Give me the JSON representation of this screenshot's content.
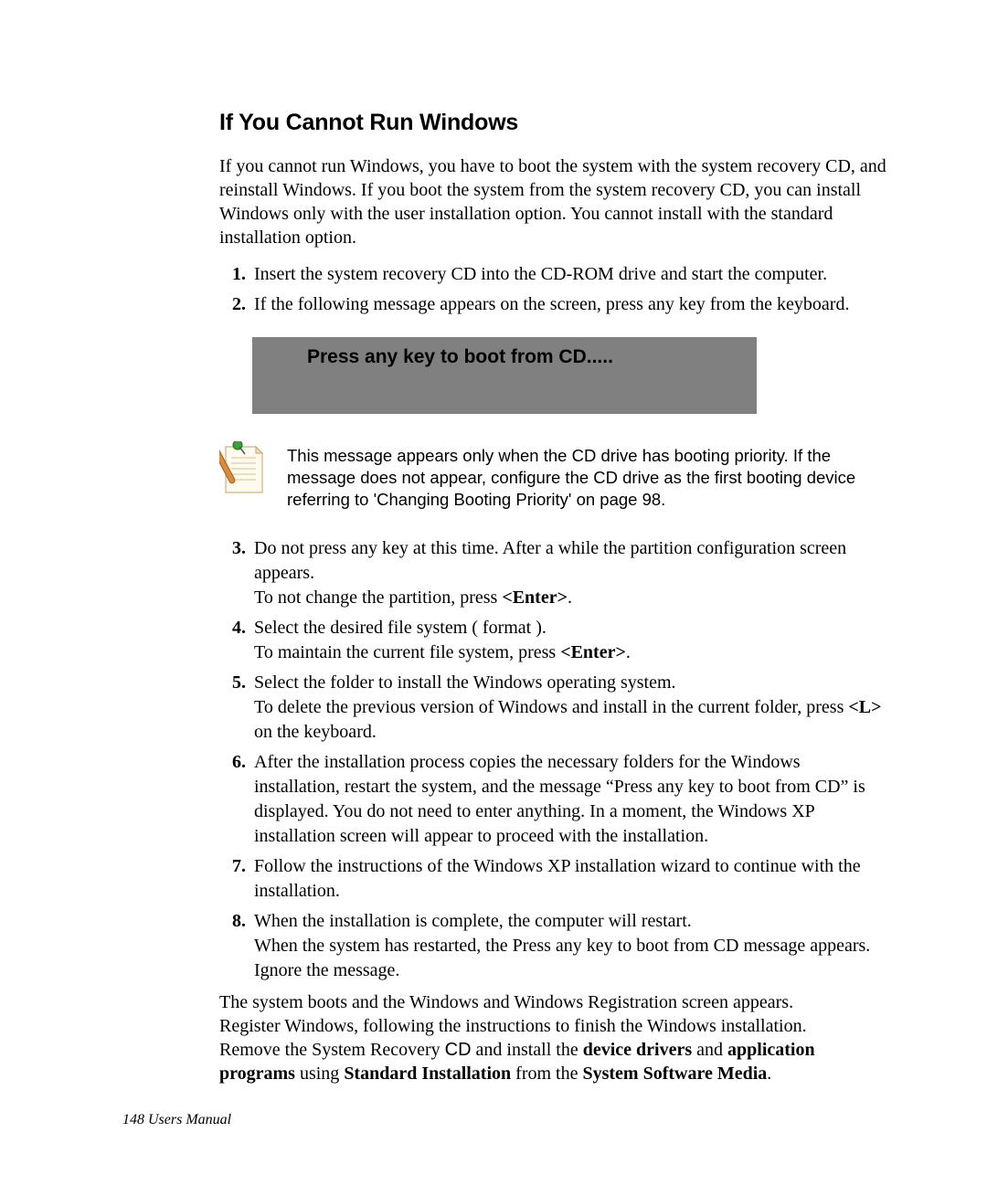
{
  "section": {
    "title": "If You Cannot Run Windows",
    "intro": "If you cannot run Windows, you have to boot the system with the system recovery CD, and reinstall Windows. If you boot the system from the system recovery CD, you can install Windows only with the user installation option. You cannot install with the standard installation option."
  },
  "steps": {
    "s1": "Insert the system recovery CD into the CD-ROM drive and start the computer.",
    "s2": "If the following message appears on the screen, press any key from the keyboard.",
    "s3a": " Do not press any key at this time. After a while the partition configuration screen appears.",
    "s3b_pre": "To not change the partition, press ",
    "s3_enter": "<Enter>",
    "s3b_post": ".",
    "s4a": "Select the desired file system ( format ).",
    "s4b_pre": "To maintain the current file system, press ",
    "s4b_post": ".",
    "s5a": "Select the folder to install the Windows operating system.",
    "s5b_pre": "To delete the previous version of Windows and install in the current folder, press ",
    "s5_L": "<L>",
    "s5b_post": " on the keyboard.",
    "s6": "After the installation process copies the necessary folders for the Windows installation, restart the system, and the message “Press any key to boot from CD” is displayed. You do not need to enter anything. In a moment, the Windows XP installation screen will appear to proceed with the installation.",
    "s7": "Follow the instructions of the Windows XP installation wizard to continue with the installation.",
    "s8a": "When the installation is complete, the computer will restart.",
    "s8b": "When the system has restarted, the Press any key to boot from CD message appears. Ignore the message."
  },
  "bootbox": {
    "text": "Press any key to  boot from CD....."
  },
  "note": {
    "text": "This message appears only when the CD drive has booting priority. If the message does not appear, configure the CD drive as the first booting device referring to 'Changing Booting Priority' on page 98."
  },
  "closing": {
    "line1": "The system boots and the Windows and Windows Registration screen appears.",
    "line2": "Register Windows, following the instructions to finish the Windows installation.",
    "line3_pre": "Remove the System Recovery ",
    "line3_cd": "CD",
    "line3_mid1": " and install the ",
    "b_device": "device drivers",
    "line3_and": " and ",
    "b_app": "application programs",
    "line3_mid2": " using ",
    "b_std": "Standard Installation",
    "line3_mid3": " from the ",
    "b_media": "System Software Media",
    "line3_end": "."
  },
  "footer": {
    "text": "148  Users Manual"
  }
}
